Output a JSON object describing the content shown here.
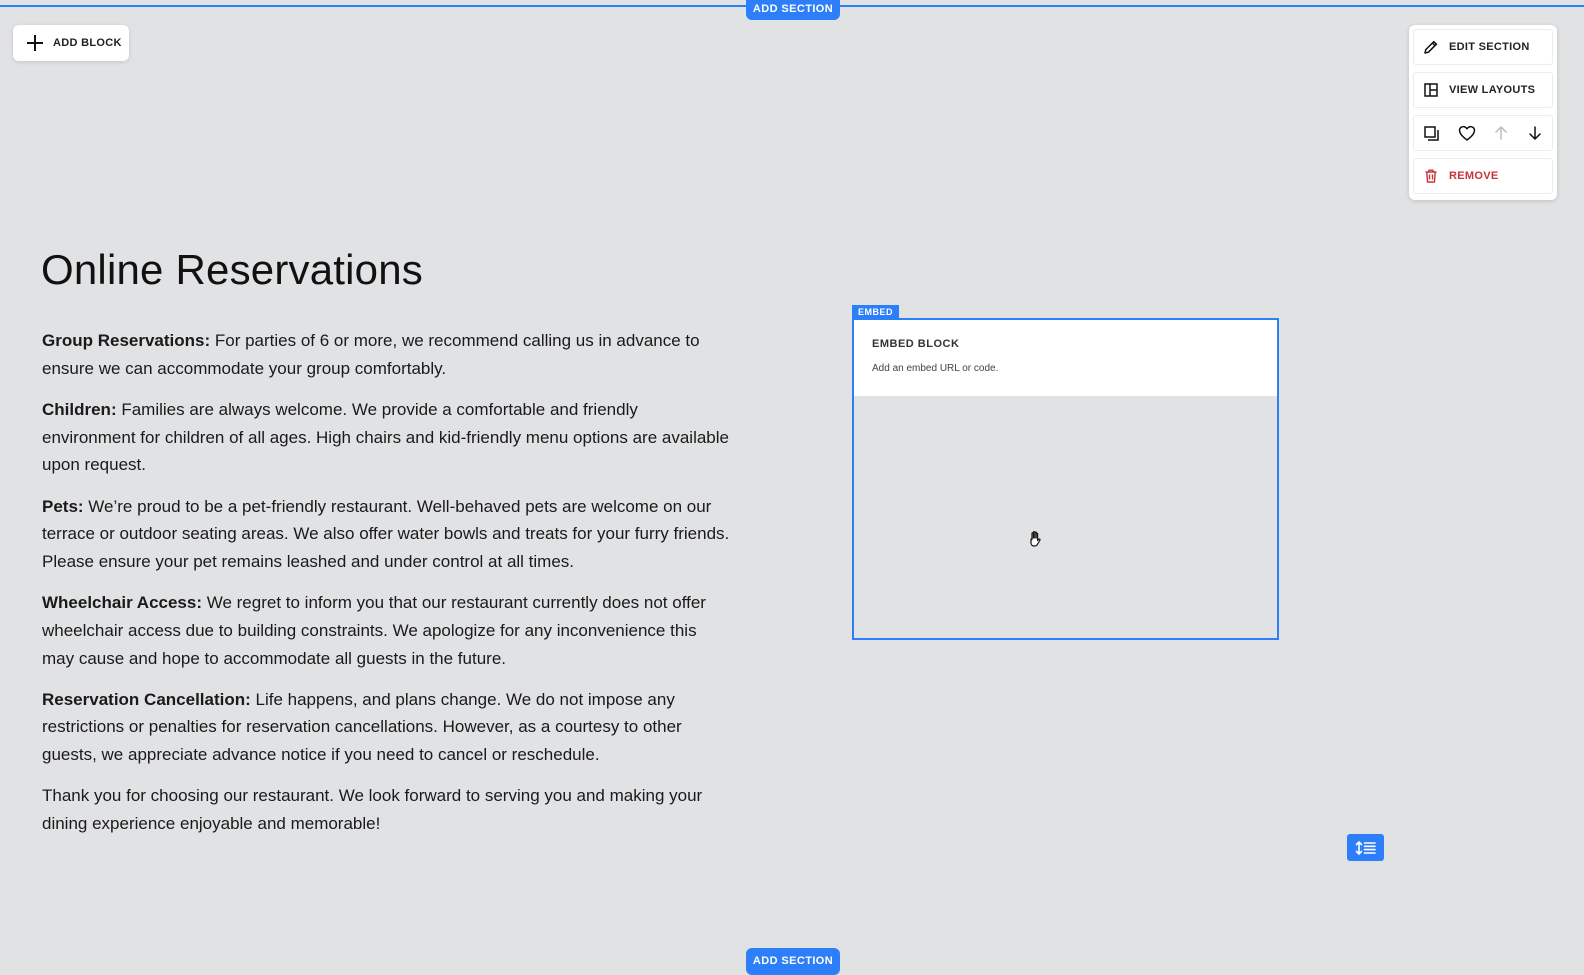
{
  "editor": {
    "add_section_label": "ADD SECTION",
    "add_block_label": "ADD BLOCK",
    "accent_color": "#2d7ff9"
  },
  "section_panel": {
    "edit_section_label": "EDIT SECTION",
    "view_layouts_label": "VIEW LAYOUTS",
    "remove_label": "REMOVE",
    "remove_color": "#c8323a",
    "icons": [
      "duplicate-icon",
      "heart-icon",
      "arrow-up-icon",
      "arrow-down-icon"
    ]
  },
  "page": {
    "title": "Online Reservations",
    "paragraphs": [
      {
        "label": "Group Reservations:",
        "text": " For parties of 6 or more, we recommend calling us in advance to ensure we can accommodate your group comfortably."
      },
      {
        "label": "Children:",
        "text": " Families are always welcome. We provide a comfortable and friendly environment for children of all ages. High chairs and kid-friendly menu options are available upon request."
      },
      {
        "label": "Pets:",
        "text": " We’re proud to be a pet-friendly restaurant. Well-behaved pets are welcome on our terrace or outdoor seating areas. We also offer water bowls and treats for your furry friends. Please ensure your pet remains leashed and under control at all times."
      },
      {
        "label": "Wheelchair Access:",
        "text": " We regret to inform you that our restaurant currently does not offer wheelchair access due to building constraints. We apologize for any inconvenience this may cause and hope to accommodate all guests in the future."
      },
      {
        "label": "Reservation Cancellation:",
        "text": " Life happens, and plans change. We do not impose any restrictions or penalties for reservation cancellations. However, as a courtesy to other guests, we appreciate advance notice if you need to cancel or reschedule."
      }
    ],
    "closing": "Thank you for choosing our restaurant. We look forward to serving you and making your dining experience enjoyable and memorable!"
  },
  "embed": {
    "tag": "EMBED",
    "title": "EMBED BLOCK",
    "description": "Add an embed URL or code."
  }
}
